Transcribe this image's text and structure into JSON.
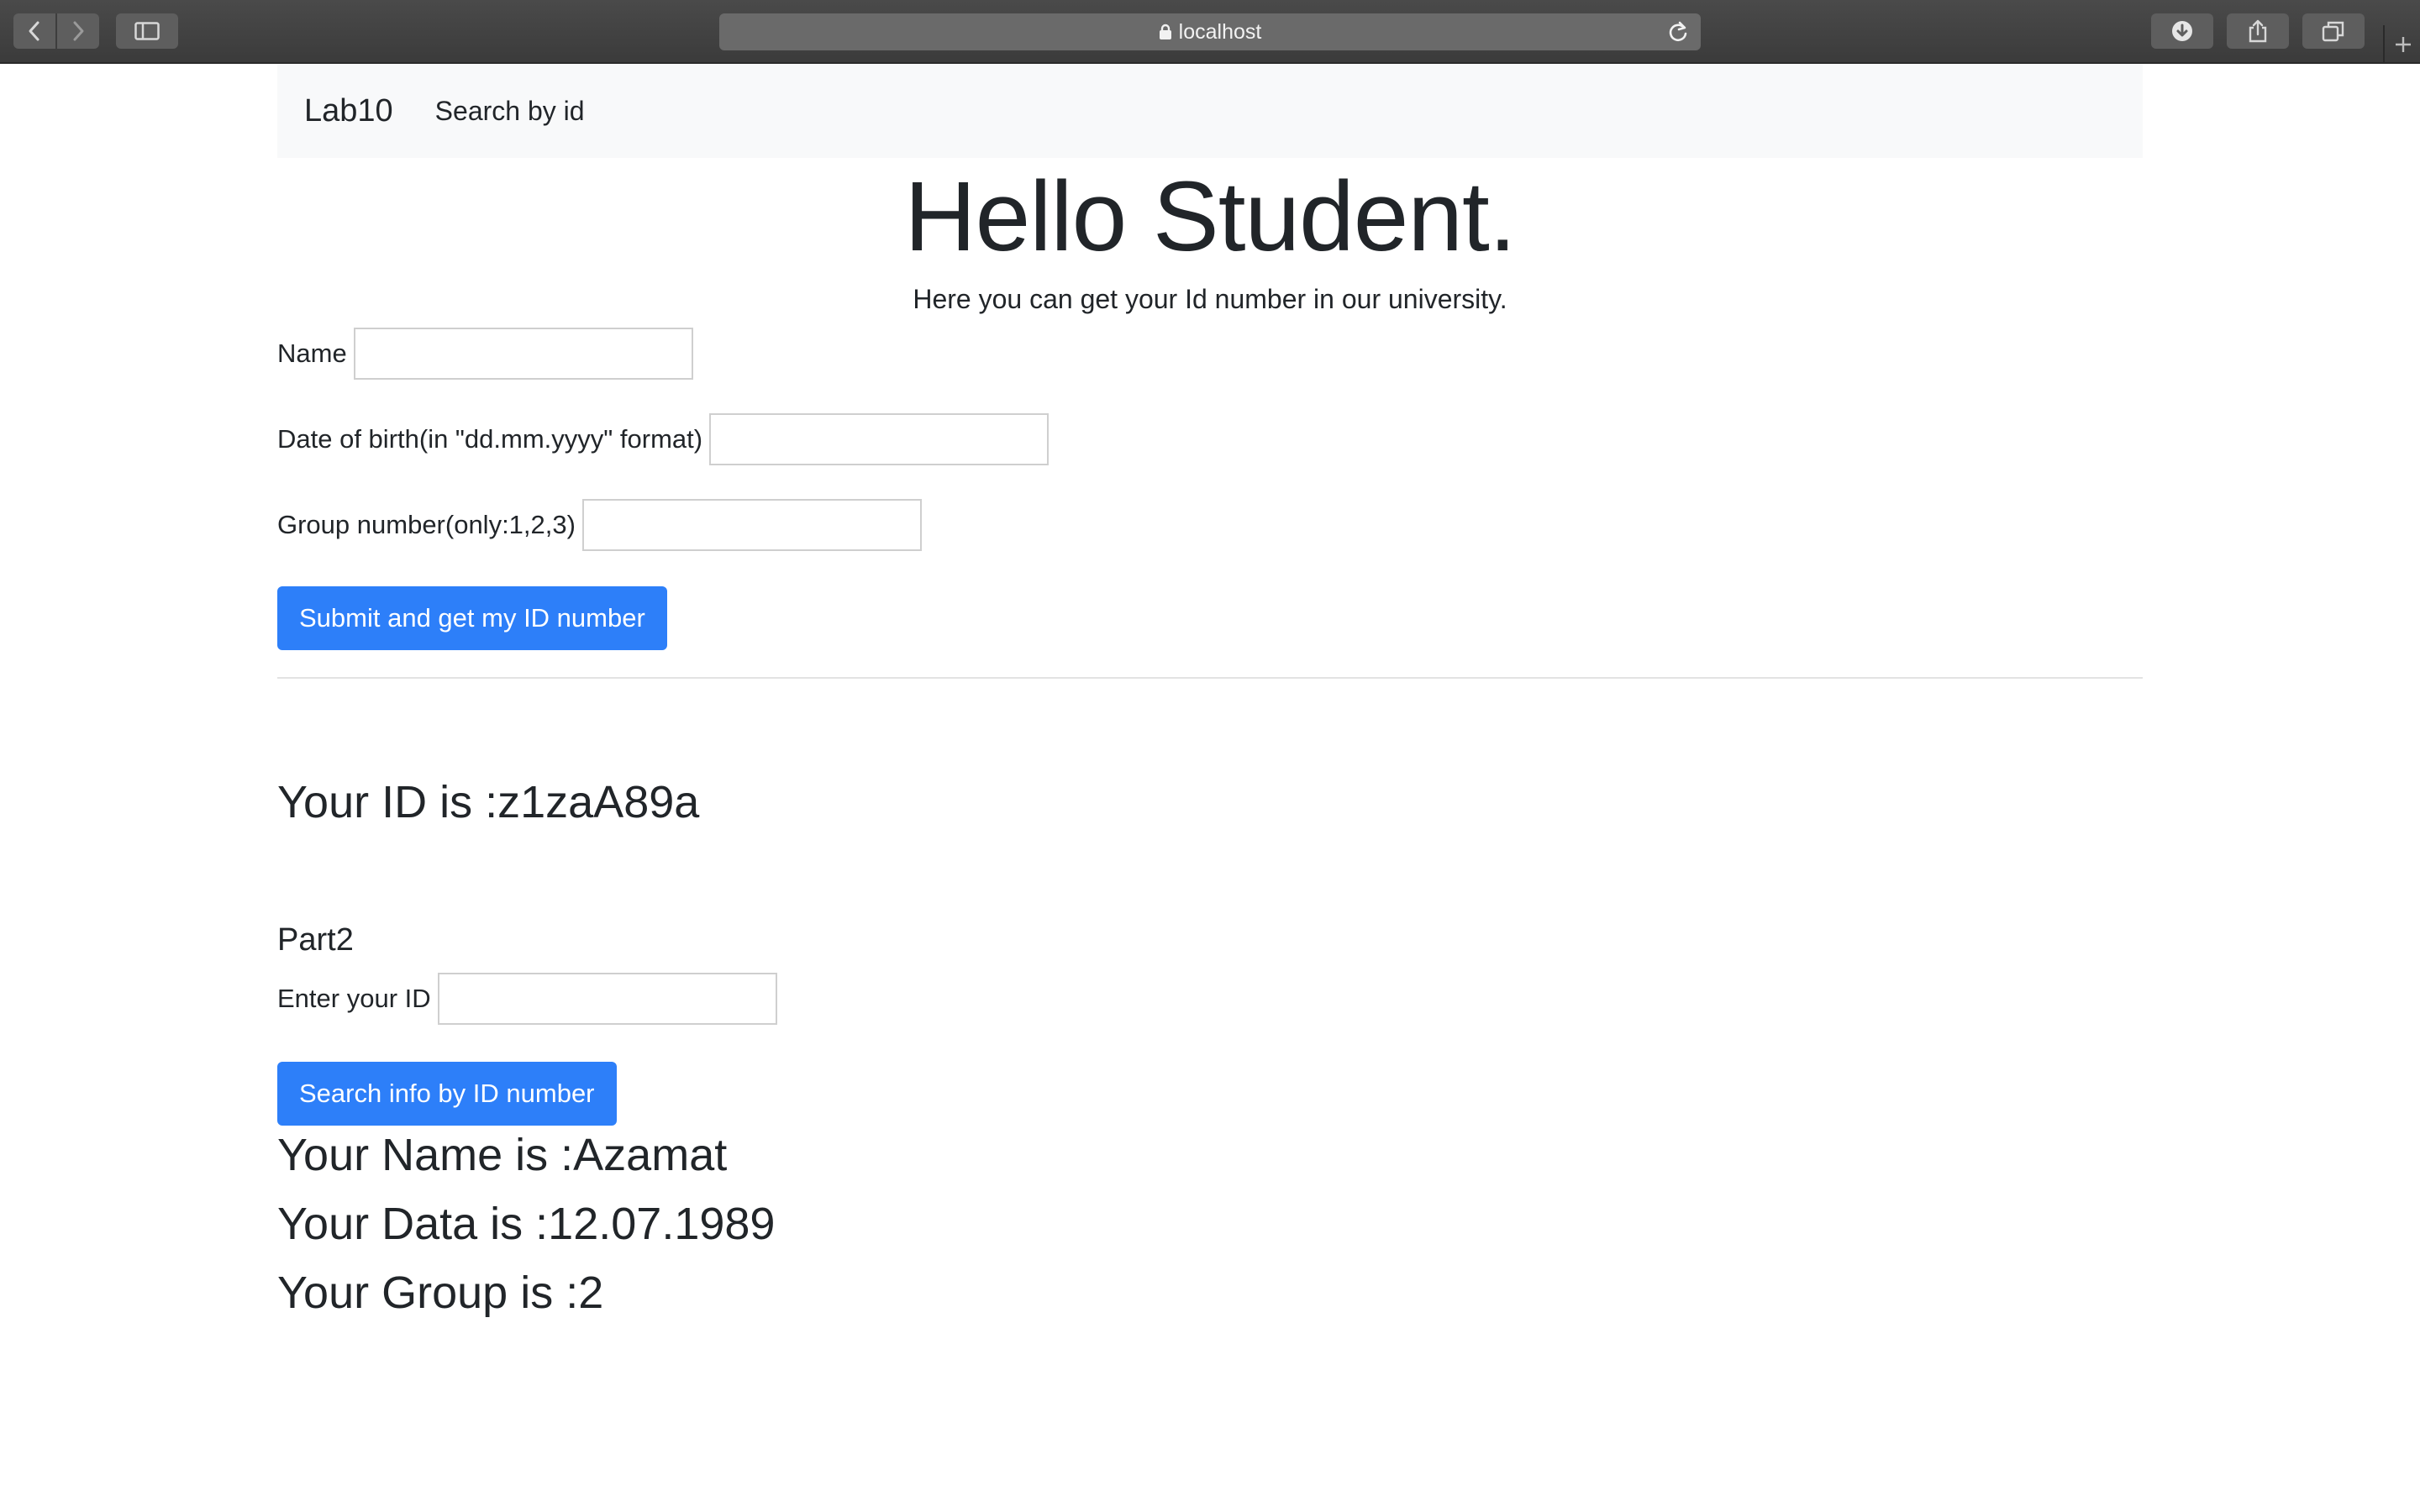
{
  "browser": {
    "address": "localhost",
    "icons": {
      "back": "chevron-left-icon",
      "forward": "chevron-right-icon",
      "sidebar": "sidebar-icon",
      "lock": "lock-icon",
      "reload": "reload-icon",
      "downloads": "download-icon",
      "share": "share-icon",
      "tabs": "tabs-icon",
      "new_tab": "plus-icon"
    }
  },
  "navbar": {
    "brand": "Lab10",
    "link": "Search by id"
  },
  "hero": {
    "title": "Hello Student.",
    "subtitle": "Here you can get your Id number in our university."
  },
  "form": {
    "name_label": "Name",
    "name_value": "",
    "dob_label": "Date of birth(in \"dd.mm.yyyy\" format)",
    "dob_value": "",
    "group_label": "Group number(only:1,2,3)",
    "group_value": "",
    "submit_label": "Submit and get my ID number"
  },
  "result": {
    "id_text": "Your ID is :z1zaA89a"
  },
  "part2": {
    "title": "Part2",
    "id_label": "Enter your ID",
    "id_value": "",
    "search_label": "Search info by ID number",
    "name_text": "Your Name is :Azamat",
    "data_text": "Your Data is :12.07.1989",
    "group_text": "Your Group is :2"
  },
  "colors": {
    "primary": "#2d7ff9",
    "navbar_bg": "#f8f9fa",
    "text": "#212529"
  }
}
